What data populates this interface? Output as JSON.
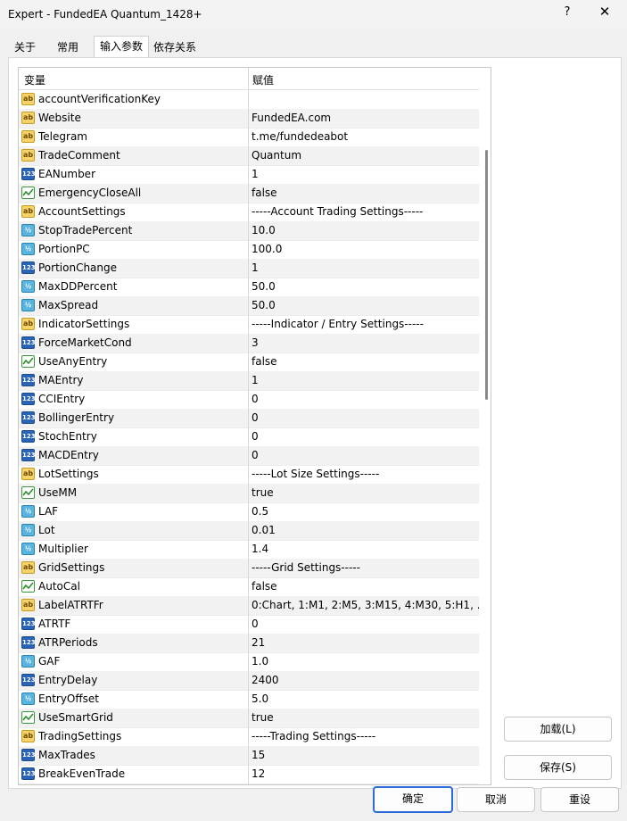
{
  "window": {
    "title": "Expert - FundedEA Quantum_1428+",
    "help_label": "?",
    "close_label": "✕"
  },
  "tabs": [
    "关于",
    "常用",
    "输入参数",
    "依存关系"
  ],
  "grid": {
    "col_variable": "变量",
    "col_value": "赋值",
    "rows": [
      {
        "icon": "ab",
        "name": "accountVerificationKey",
        "value": ""
      },
      {
        "icon": "ab",
        "name": "Website",
        "value": "FundedEA.com"
      },
      {
        "icon": "ab",
        "name": "Telegram",
        "value": "t.me/fundedeabot"
      },
      {
        "icon": "ab",
        "name": "TradeComment",
        "value": "Quantum"
      },
      {
        "icon": "123",
        "name": "EANumber",
        "value": "1"
      },
      {
        "icon": "bool",
        "name": "EmergencyCloseAll",
        "value": "false"
      },
      {
        "icon": "ab",
        "name": "AccountSettings",
        "value": "-----Account Trading Settings-----"
      },
      {
        "icon": "v2",
        "name": "StopTradePercent",
        "value": "10.0"
      },
      {
        "icon": "v2",
        "name": "PortionPC",
        "value": "100.0"
      },
      {
        "icon": "123",
        "name": "PortionChange",
        "value": "1"
      },
      {
        "icon": "v2",
        "name": "MaxDDPercent",
        "value": "50.0"
      },
      {
        "icon": "v2",
        "name": "MaxSpread",
        "value": "50.0"
      },
      {
        "icon": "ab",
        "name": "IndicatorSettings",
        "value": "-----Indicator / Entry Settings-----"
      },
      {
        "icon": "123",
        "name": "ForceMarketCond",
        "value": "3"
      },
      {
        "icon": "bool",
        "name": "UseAnyEntry",
        "value": "false"
      },
      {
        "icon": "123",
        "name": "MAEntry",
        "value": "1"
      },
      {
        "icon": "123",
        "name": "CCIEntry",
        "value": "0"
      },
      {
        "icon": "123",
        "name": "BollingerEntry",
        "value": "0"
      },
      {
        "icon": "123",
        "name": "StochEntry",
        "value": "0"
      },
      {
        "icon": "123",
        "name": "MACDEntry",
        "value": "0"
      },
      {
        "icon": "ab",
        "name": "LotSettings",
        "value": "-----Lot Size Settings-----"
      },
      {
        "icon": "bool",
        "name": "UseMM",
        "value": "true"
      },
      {
        "icon": "v2",
        "name": "LAF",
        "value": "0.5"
      },
      {
        "icon": "v2",
        "name": "Lot",
        "value": "0.01"
      },
      {
        "icon": "v2",
        "name": "Multiplier",
        "value": "1.4"
      },
      {
        "icon": "ab",
        "name": "GridSettings",
        "value": "-----Grid Settings-----"
      },
      {
        "icon": "bool",
        "name": "AutoCal",
        "value": "false"
      },
      {
        "icon": "ab",
        "name": "LabelATRTFr",
        "value": "0:Chart, 1:M1, 2:M5, 3:M15, 4:M30, 5:H1, ..."
      },
      {
        "icon": "123",
        "name": "ATRTF",
        "value": "0"
      },
      {
        "icon": "123",
        "name": "ATRPeriods",
        "value": "21"
      },
      {
        "icon": "v2",
        "name": "GAF",
        "value": "1.0"
      },
      {
        "icon": "123",
        "name": "EntryDelay",
        "value": "2400"
      },
      {
        "icon": "v2",
        "name": "EntryOffset",
        "value": "5.0"
      },
      {
        "icon": "bool",
        "name": "UseSmartGrid",
        "value": "true"
      },
      {
        "icon": "ab",
        "name": "TradingSettings",
        "value": "-----Trading Settings-----"
      },
      {
        "icon": "123",
        "name": "MaxTrades",
        "value": "15"
      },
      {
        "icon": "123",
        "name": "BreakEvenTrade",
        "value": "12"
      }
    ]
  },
  "side_buttons": {
    "load": "加载(L)",
    "save": "保存(S)"
  },
  "footer_buttons": {
    "ok": "确定",
    "cancel": "取消",
    "reset": "重设"
  },
  "icon_labels": {
    "ab": "ab",
    "123": "123",
    "v2": "½"
  }
}
